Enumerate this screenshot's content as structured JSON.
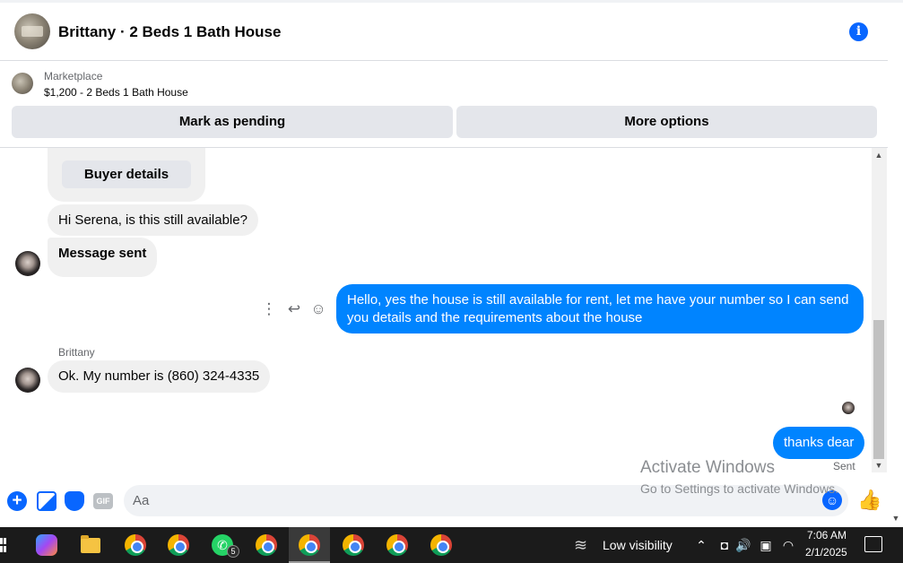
{
  "header": {
    "title": "Brittany · 2 Beds 1 Bath House",
    "info_icon": "info-icon"
  },
  "marketplace": {
    "label": "Marketplace",
    "listing": "$1,200 - 2 Beds 1 Bath House",
    "pending_button": "Mark as pending",
    "more_button": "More options"
  },
  "messages": {
    "buyer_details": "Buyer details",
    "m1": "Hi Serena, is this still available?",
    "m2": "Message sent",
    "m3": "Hello, yes the house is still available for rent, let me have your number so I can send you details and the requirements about the house",
    "sender": "Brittany",
    "m4": "Ok. My number is (860) 324-4335",
    "m5": "thanks dear",
    "status": "Sent"
  },
  "composer": {
    "placeholder": "Aa",
    "gif_label": "GIF"
  },
  "watermark": {
    "title": "Activate Windows",
    "subtitle": "Go to Settings to activate Windows."
  },
  "taskbar": {
    "weather": "Low visibility",
    "time": "7:06 AM",
    "date": "2/1/2025",
    "whatsapp_badge": "5"
  },
  "colors": {
    "accent": "#0866ff",
    "outgoing_bubble": "#0084ff",
    "incoming_bubble": "#f0f0f0",
    "taskbar": "#1b1b1b"
  }
}
